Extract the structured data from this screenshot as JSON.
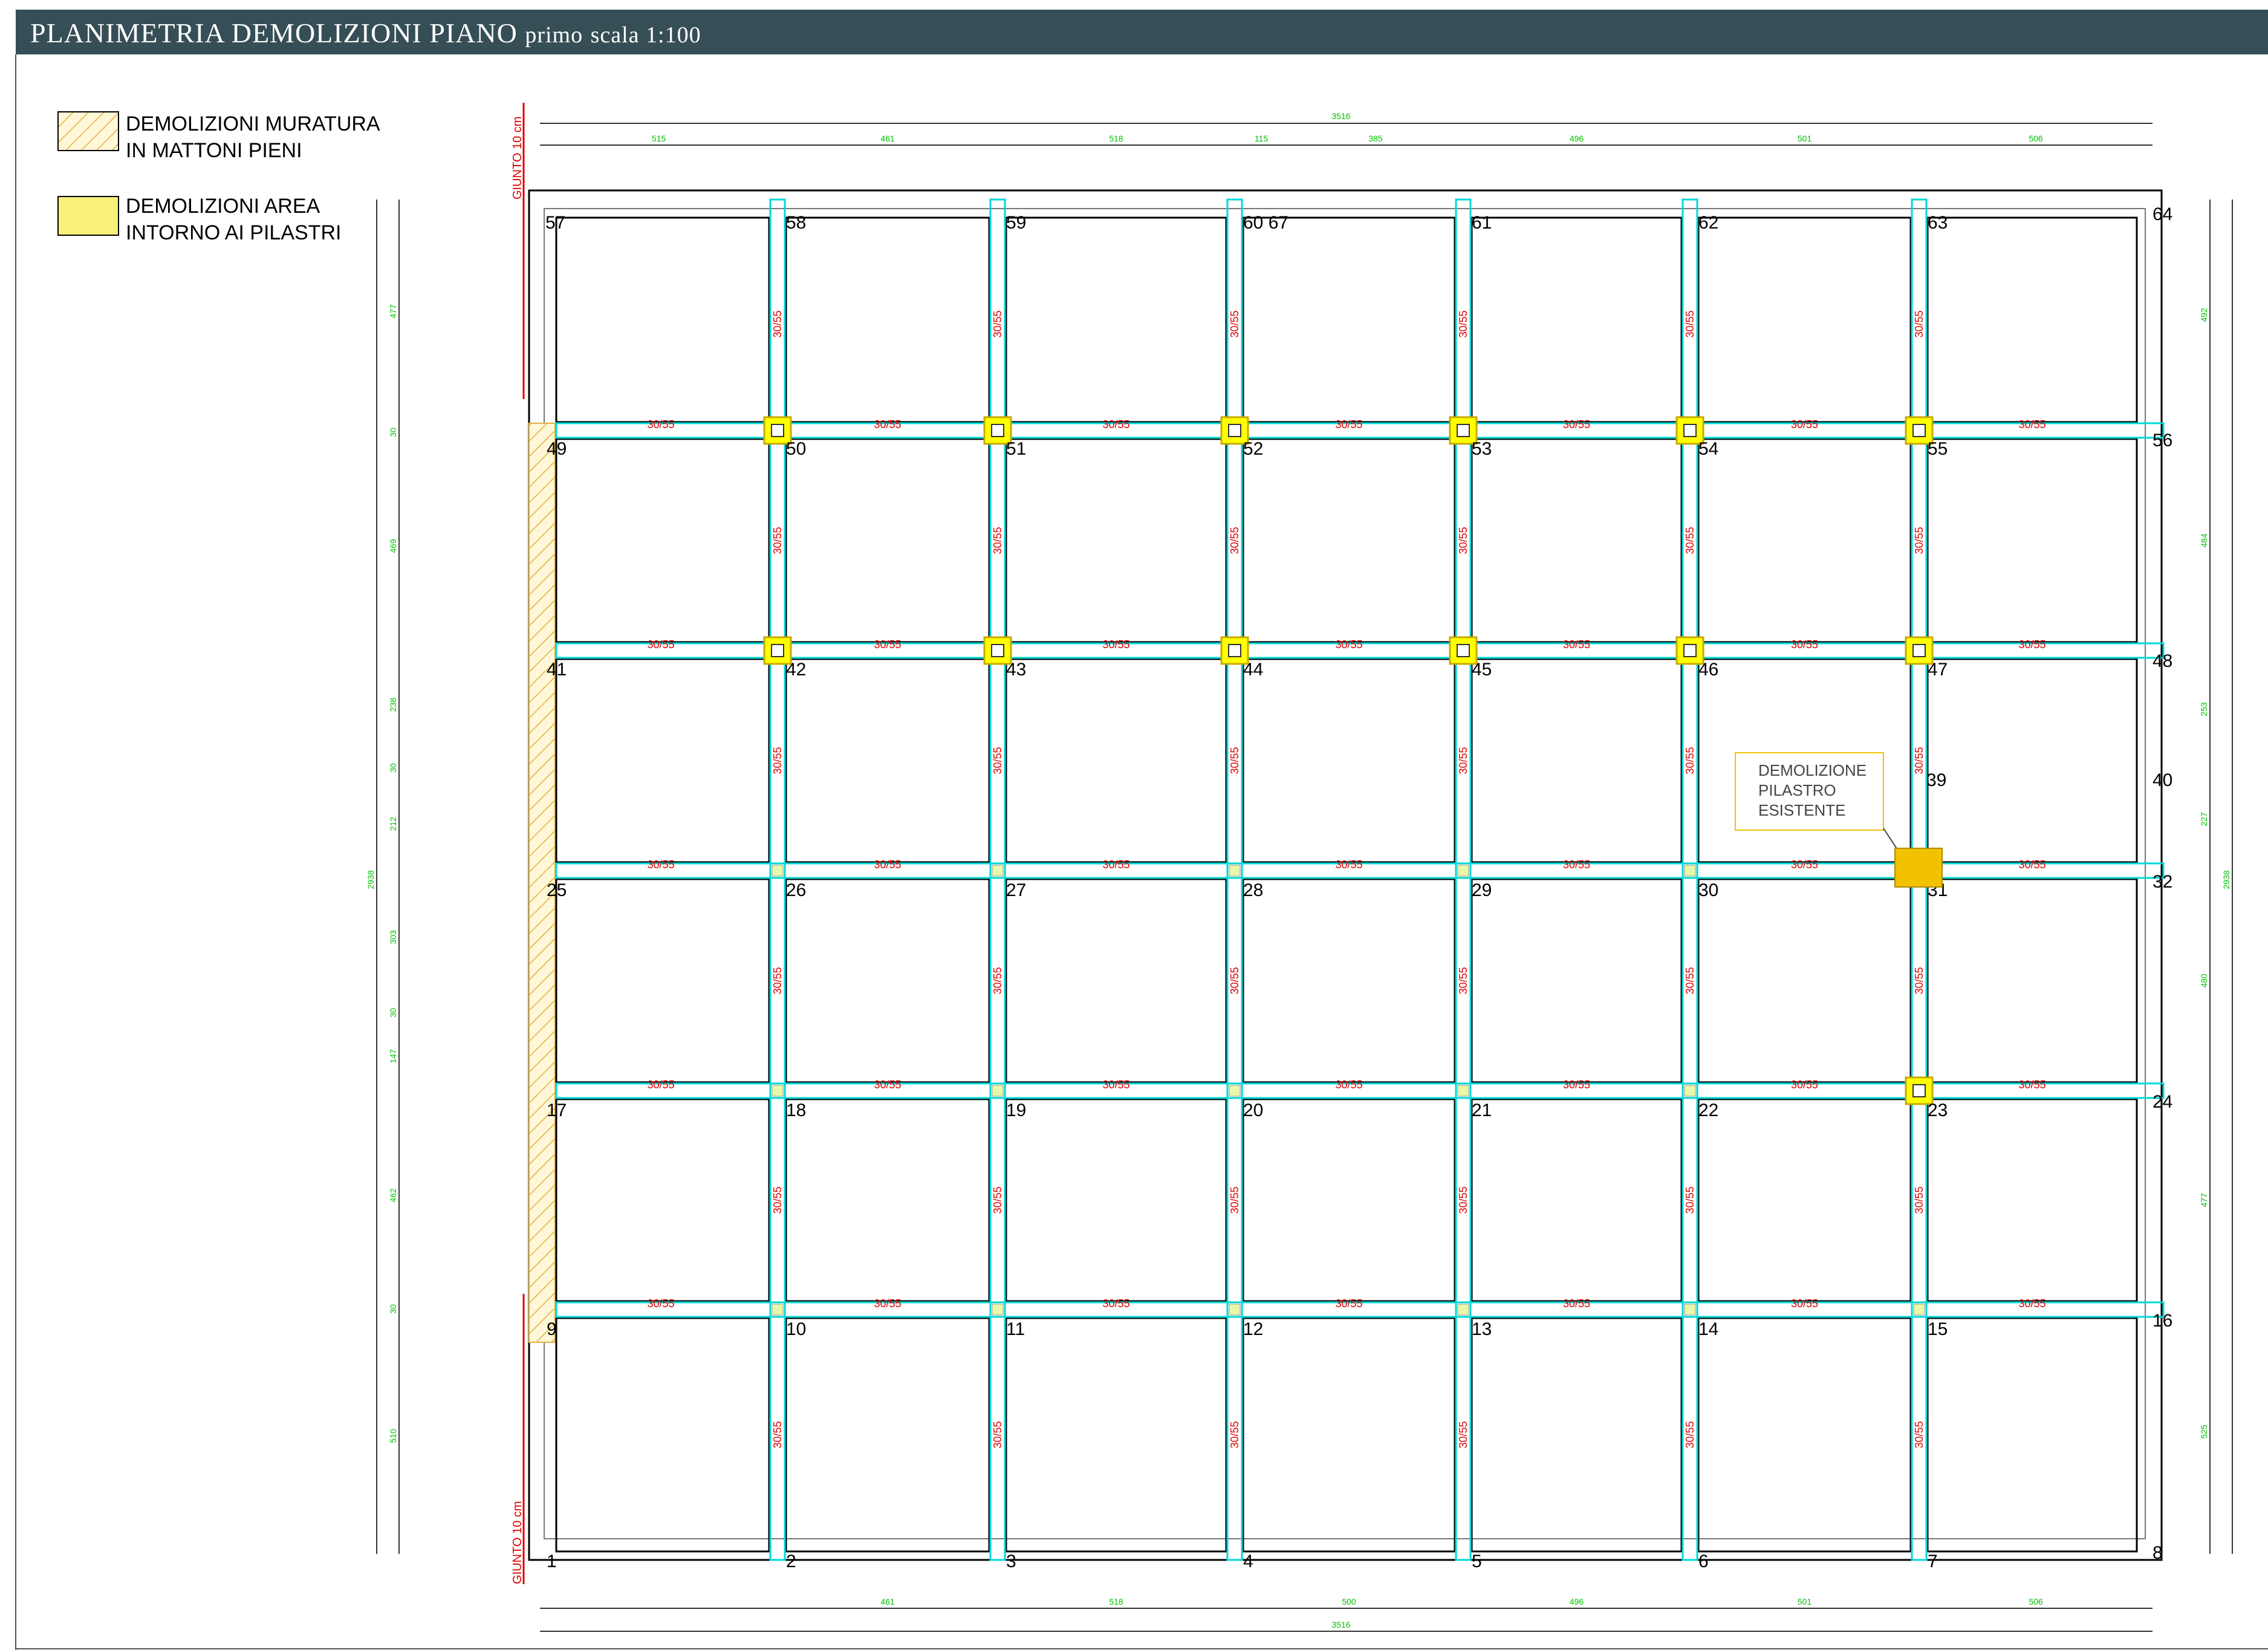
{
  "title": {
    "main": "PLANIMETRIA DEMOLIZIONI PIANO",
    "floor": "primo",
    "scale": "scala 1:100"
  },
  "legend": [
    {
      "line1": "DEMOLIZIONI MURATURA",
      "line2": "IN MATTONI PIENI",
      "swatch": "hatch"
    },
    {
      "line1": "DEMOLIZIONI AREA",
      "line2": "INTORNO AI PILASTRI",
      "swatch": "fill"
    }
  ],
  "joint_label": "GIUNTO 10 cm",
  "callout": {
    "line1": "DEMOLIZIONE",
    "line2": "PILASTRO",
    "line3": "ESISTENTE"
  },
  "beam_label": "30/55",
  "colors": {
    "title_bar": "#364f56",
    "beam": "#00d8d8",
    "beam_text": "#e00000",
    "dimension_text": "#00c000",
    "pillar_fill": "#ffff00",
    "pillar_stroke": "#c8a800",
    "callout_fill": "#f2c200",
    "hatch": "#e0b040",
    "joint_line": "#e00000"
  },
  "nodes": {
    "row_y360": [
      "57",
      "58",
      "59",
      "60 67",
      "61",
      "62",
      "63",
      "64"
    ],
    "row_y740": [
      "49",
      "50",
      "51",
      "52",
      "53",
      "54",
      "55",
      "56"
    ],
    "row_y1105": [
      "41",
      "42",
      "43",
      "44",
      "45",
      "46",
      "47",
      "48"
    ],
    "row_1290": [
      "39",
      "40"
    ],
    "row_y1470": [
      "25",
      "26",
      "27",
      "28",
      "29",
      "30",
      "31",
      "32"
    ],
    "row_y1835": [
      "17",
      "18",
      "19",
      "20",
      "21",
      "22",
      "23",
      "24"
    ],
    "row_y2197": [
      "9",
      "10",
      "11",
      "12",
      "13",
      "14",
      "15",
      "16"
    ],
    "row_y2580": [
      "1",
      "2",
      "3",
      "4",
      "5",
      "6",
      "7",
      "8"
    ]
  },
  "dims": {
    "top_total": "3516",
    "top_parts": [
      "515",
      "461",
      "518",
      "115",
      "385",
      "496",
      "501",
      "506"
    ],
    "bottom_parts": [
      "461",
      "518",
      "500",
      "496",
      "501",
      "506"
    ],
    "bottom_total": "3516",
    "left_parts": [
      "477",
      "30",
      "469",
      "238",
      "30",
      "212",
      "303",
      "30",
      "147",
      "462",
      "30",
      "510"
    ],
    "left_total": "2938",
    "right_parts": [
      "492",
      "484",
      "253",
      "227",
      "480",
      "477",
      "525"
    ],
    "right_total": "2938"
  }
}
